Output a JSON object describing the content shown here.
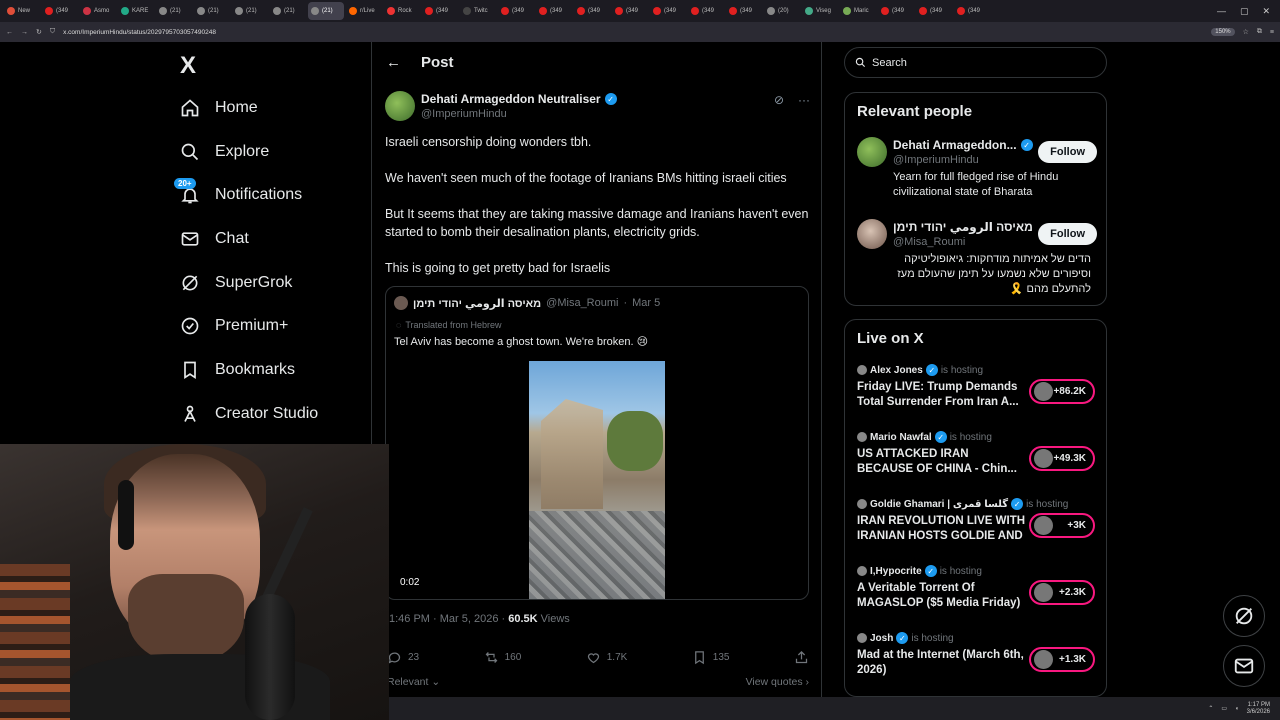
{
  "browser": {
    "tabs": [
      "New",
      "(349",
      "Asmo",
      "KARE",
      "(21)",
      "(21)",
      "(21)",
      "(21)",
      "(21)",
      "r/Live",
      "Rock",
      "(349",
      "Twitc",
      "(349",
      "(349",
      "(349",
      "(349",
      "(349",
      "(349",
      "(349",
      "(20)",
      "Viseg",
      "Maric",
      "(349",
      "(349",
      "(349"
    ],
    "url": "x.com/ImperiumHindu/status/2029795703057490248",
    "zoom": "150%"
  },
  "nav": {
    "logo": "X",
    "items": [
      {
        "label": "Home",
        "icon": "home-icon"
      },
      {
        "label": "Explore",
        "icon": "search-icon"
      },
      {
        "label": "Notifications",
        "icon": "bell-icon",
        "badge": "20+"
      },
      {
        "label": "Chat",
        "icon": "mail-icon"
      },
      {
        "label": "SuperGrok",
        "icon": "grok-icon"
      },
      {
        "label": "Premium+",
        "icon": "premium-icon"
      },
      {
        "label": "Bookmarks",
        "icon": "bookmark-icon"
      },
      {
        "label": "Creator Studio",
        "icon": "creator-icon"
      }
    ]
  },
  "post": {
    "header": "Post",
    "author_name": "Dehati Armageddon Neutraliser",
    "author_handle": "@ImperiumHindu",
    "text": [
      "Israeli censorship doing wonders tbh.",
      "We haven't seen much of the footage of Iranians BMs hitting israeli cities",
      "But It seems that they are taking massive damage and Iranians haven't even started to bomb their desalination plants, electricity grids.",
      "This is going to get pretty bad for Israelis"
    ],
    "quote": {
      "name": "מאיסה الرومي יהודי תימן",
      "handle": "@Misa_Roumi",
      "date": "Mar 5",
      "translated": "Translated from Hebrew",
      "text": "Tel Aviv has become a ghost town. We're broken. 😢",
      "video_time": "0:02"
    },
    "timestamp": "1:46 PM · Mar 5, 2026",
    "views_count": "60.5K",
    "views_label": "Views",
    "replies": "23",
    "reposts": "160",
    "likes": "1.7K",
    "bookmarks": "135",
    "sort_label": "Relevant",
    "view_quotes": "View quotes"
  },
  "search": {
    "placeholder": "Search"
  },
  "relevant_people": {
    "title": "Relevant people",
    "people": [
      {
        "name": "Dehati Armageddon...",
        "handle": "@ImperiumHindu",
        "bio": "Yearn for full fledged rise of Hindu civilizational state of Bharata",
        "follow": "Follow"
      },
      {
        "name": "מאיסה الرومي יהודי תימן",
        "handle": "@Misa_Roumi",
        "bio": "הדים של אמיתות מודחקות: גיאופוליטיקה וסיפורים שלא נשמעו על תימן שהעולם מעז להתעלם מהם 🎗️",
        "follow": "Follow"
      }
    ]
  },
  "live": {
    "title": "Live on X",
    "items": [
      {
        "host": "Alex Jones",
        "status": "is hosting",
        "title": "Friday LIVE: Trump Demands Total Surrender From Iran A...",
        "count": "+86.2K"
      },
      {
        "host": "Mario Nawfal",
        "status": "is hosting",
        "title": "US ATTACKED IRAN BECAUSE OF CHINA - Chin...",
        "count": "+49.3K"
      },
      {
        "host": "Goldie Ghamari | گلسا قمری",
        "status": "is hosting",
        "title": "IRAN REVOLUTION LIVE WITH IRANIAN HOSTS GOLDIE AND ...",
        "count": "+3K"
      },
      {
        "host": "I,Hypocrite",
        "status": "is hosting",
        "title": "A Veritable Torrent Of MAGASLOP ($5 Media Friday)",
        "count": "+2.3K"
      },
      {
        "host": "Josh",
        "status": "is hosting",
        "title": "Mad at the Internet (March 6th, 2026)",
        "count": "+1.3K"
      }
    ]
  },
  "taskbar": {
    "time": "1:17 PM",
    "date": "3/6/2026"
  },
  "colors": {
    "accent": "#1d9bf0",
    "live": "#f91880",
    "bg": "#000000",
    "muted": "#71767b"
  }
}
